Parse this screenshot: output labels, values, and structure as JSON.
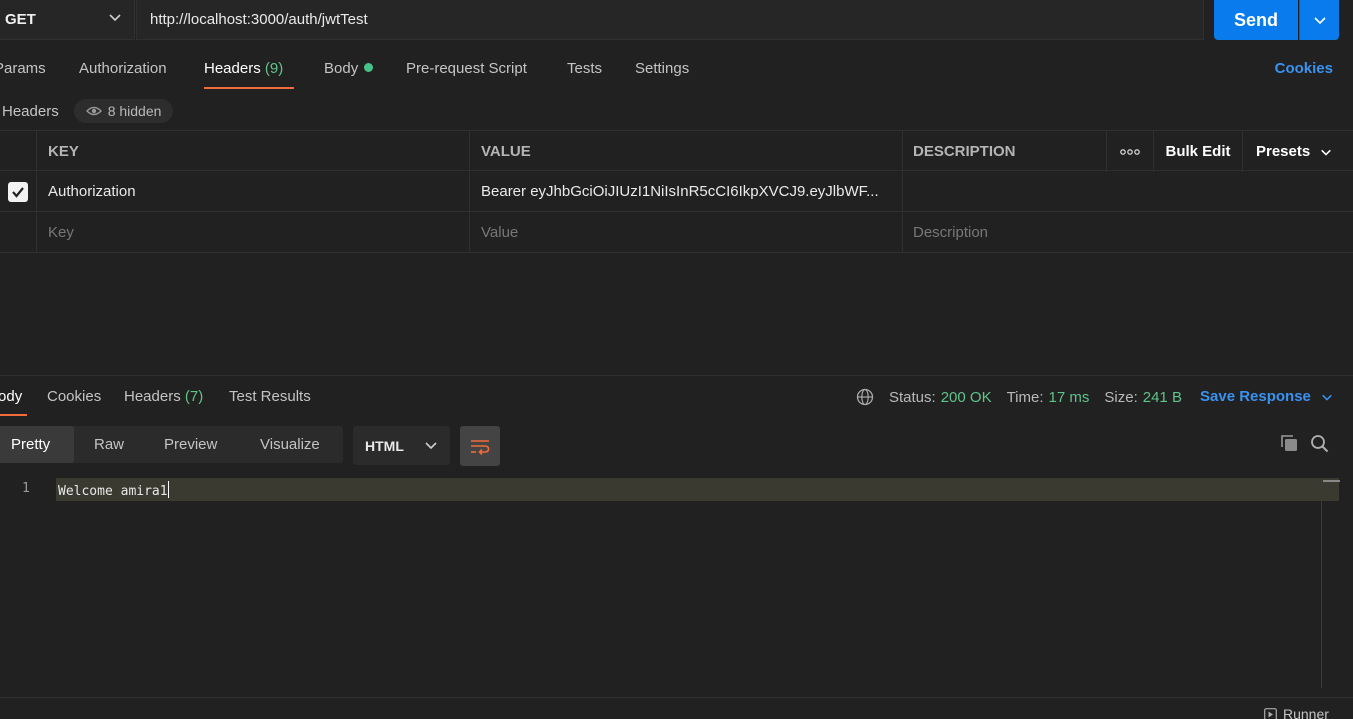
{
  "request": {
    "method": "GET",
    "url": "http://localhost:3000/auth/jwtTest",
    "send_label": "Send"
  },
  "request_tabs": {
    "params": "Params",
    "authorization": "Authorization",
    "headers": "Headers",
    "headers_count": "(9)",
    "body": "Body",
    "prerequest": "Pre-request Script",
    "tests": "Tests",
    "settings": "Settings",
    "cookies": "Cookies"
  },
  "headers_section": {
    "title": "Headers",
    "hidden_label": "8 hidden"
  },
  "headers_table": {
    "col_key": "KEY",
    "col_value": "VALUE",
    "col_description": "DESCRIPTION",
    "more_label": "ooo",
    "bulk_edit": "Bulk Edit",
    "presets": "Presets",
    "rows": [
      {
        "checked": true,
        "key": "Authorization",
        "value": "Bearer eyJhbGciOiJIUzI1NiIsInR5cCI6IkpXVCJ9.eyJlbWF...",
        "description": ""
      }
    ],
    "placeholder_key": "Key",
    "placeholder_value": "Value",
    "placeholder_description": "Description"
  },
  "response_tabs": {
    "body": "Body",
    "cookies": "Cookies",
    "headers": "Headers",
    "headers_count": "(7)",
    "test_results": "Test Results"
  },
  "response_status": {
    "status_label": "Status:",
    "status_value": "200 OK",
    "time_label": "Time:",
    "time_value": "17 ms",
    "size_label": "Size:",
    "size_value": "241 B",
    "save_response": "Save Response"
  },
  "view_modes": {
    "pretty": "Pretty",
    "raw": "Raw",
    "preview": "Preview",
    "visualize": "Visualize",
    "format": "HTML"
  },
  "editor": {
    "line_number": "1",
    "content": "Welcome amira1"
  },
  "footer": {
    "runner": "Runner"
  },
  "colors": {
    "accent_blue": "#097bed",
    "link_blue": "#3a92f0",
    "success_green": "#5fc48a",
    "tab_underline": "#f26b3a"
  }
}
